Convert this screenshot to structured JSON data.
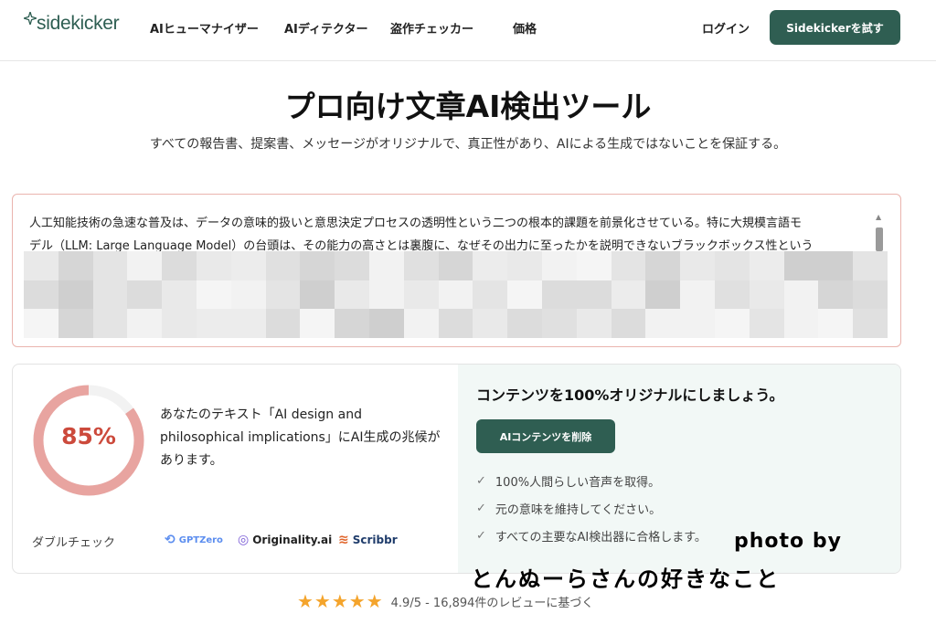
{
  "nav": {
    "logo_text": "sidekicker",
    "items": [
      "AIヒューマナイザー",
      "AIディテクター",
      "盗作チェッカー",
      "価格"
    ],
    "login": "ログイン",
    "cta": "Sidekickerを試す"
  },
  "hero": {
    "title": "プロ向け文章AI検出ツール",
    "subtitle": "すべての報告書、提案書、メッセージがオリジナルで、真正性があり、AIによる生成ではないことを保証する。"
  },
  "input": {
    "line1": "人工知能技術の急速な普及は、データの意味的扱いと意思決定プロセスの透明性という二つの根本的課題を前景化させている。特に大規模言語モ",
    "line2": "デル（LLM: Large Language Model）の台頭は、その能力の高さとは裏腹に、なぜその出力に至ったかを説明できないブラックボックス性という"
  },
  "result": {
    "percent_value": 85,
    "percent_label": "85%",
    "description": "あなたのテキスト「AI design and philosophical implications」にAI生成の兆候があります。",
    "double_check": "ダブルチェック",
    "logos": [
      {
        "icon": "gptzero-icon",
        "name": "GPTZero",
        "color": "#5b8def"
      },
      {
        "icon": "originality-icon",
        "name": "Originality.ai",
        "color": "#222222"
      },
      {
        "icon": "scribbr-icon",
        "name": "Scribbr",
        "color": "#1f3c6b"
      }
    ],
    "gauge_color": "#e8a4a0",
    "gauge_track": "#f2f2f2"
  },
  "cta_panel": {
    "title": "コンテンツを100%オリジナルにしましょう。",
    "button": "AIコンテンツを削除",
    "checks": [
      "100%人間らしい音声を取得。",
      "元の意味を維持してください。",
      "すべての主要なAI検出器に合格します。"
    ]
  },
  "rating": {
    "stars": "★★★★★",
    "text": "4.9/5 - 16,894件のレビューに基づく"
  },
  "watermark": {
    "line1": "photo by",
    "line2": "とんぬーらさんの好きなこと"
  },
  "colors": {
    "brand": "#2f5e52",
    "percent": "#cc4a3c",
    "star": "#f4a42c"
  }
}
